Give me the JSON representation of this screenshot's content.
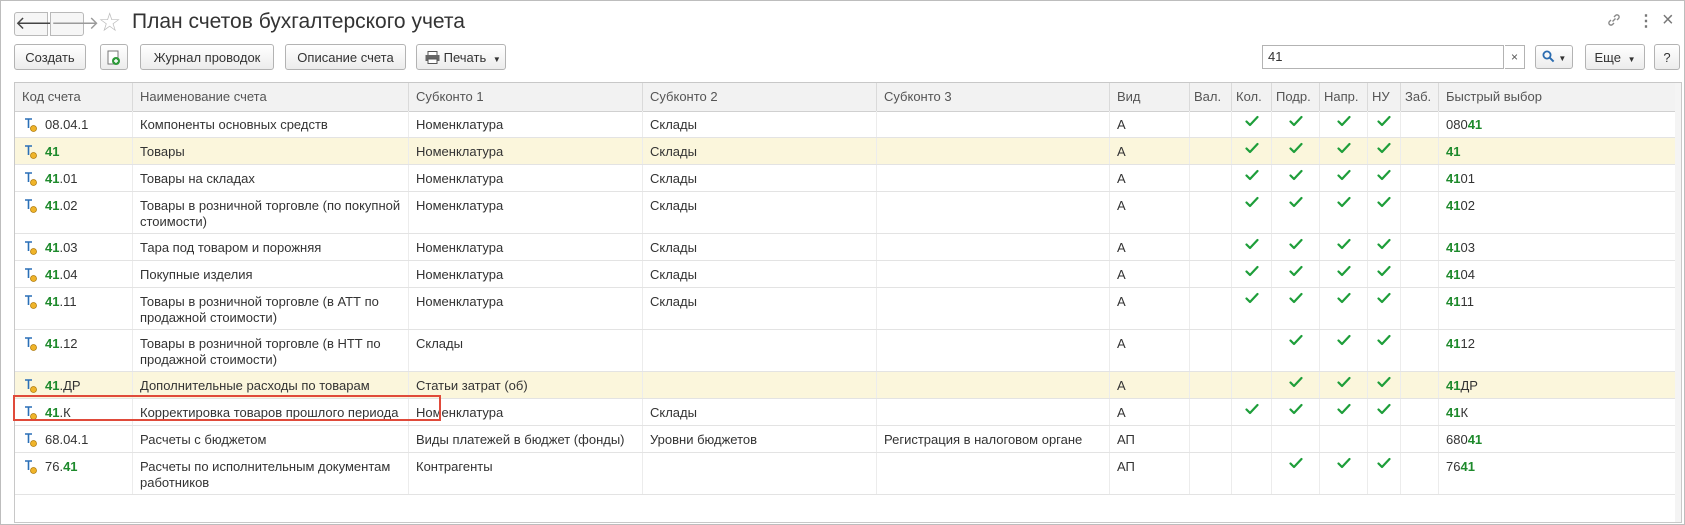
{
  "window": {
    "title": "План счетов бухгалтерского учета",
    "nav_back": "🡐",
    "nav_forward": "🡒",
    "link_icon": "link-icon",
    "menu_icon": "more-vert-icon",
    "close_icon": "close-icon"
  },
  "toolbar": {
    "create": "Создать",
    "journal": "Журнал проводок",
    "description": "Описание счета",
    "print": "Печать",
    "more": "Еще",
    "help": "?",
    "search_value": "41",
    "search_clear": "×"
  },
  "columns": [
    "Код счета",
    "Наименование счета",
    "Субконто 1",
    "Субконто 2",
    "Субконто 3",
    "Вид",
    "Вал.",
    "Кол.",
    "Подр.",
    "Напр.",
    "НУ",
    "Заб.",
    "Быстрый выбор"
  ],
  "rows": [
    {
      "code_pre": "08.04.1",
      "code_hit": "",
      "code_post": "",
      "name": "Компоненты основных средств",
      "s1": "Номенклатура",
      "s2": "Склады",
      "s3": "",
      "vid": "А",
      "kol": true,
      "podr": true,
      "napr": true,
      "nu": true,
      "qs_pre": "080",
      "qs_hit": "41",
      "qs_post": ""
    },
    {
      "code_pre": "",
      "code_hit": "41",
      "code_post": "",
      "name": "Товары",
      "s1": "Номенклатура",
      "s2": "Склады",
      "s3": "",
      "vid": "А",
      "kol": true,
      "podr": true,
      "napr": true,
      "nu": true,
      "qs_pre": "",
      "qs_hit": "41",
      "qs_post": "",
      "hl": true
    },
    {
      "code_pre": "",
      "code_hit": "41",
      "code_post": ".01",
      "name": "Товары на складах",
      "s1": "Номенклатура",
      "s2": "Склады",
      "s3": "",
      "vid": "А",
      "kol": true,
      "podr": true,
      "napr": true,
      "nu": true,
      "qs_pre": "",
      "qs_hit": "41",
      "qs_post": "01"
    },
    {
      "code_pre": "",
      "code_hit": "41",
      "code_post": ".02",
      "name": "Товары в розничной торговле (по покупной стоимости)",
      "s1": "Номенклатура",
      "s2": "Склады",
      "s3": "",
      "vid": "А",
      "kol": true,
      "podr": true,
      "napr": true,
      "nu": true,
      "qs_pre": "",
      "qs_hit": "41",
      "qs_post": "02"
    },
    {
      "code_pre": "",
      "code_hit": "41",
      "code_post": ".03",
      "name": "Тара под товаром и порожняя",
      "s1": "Номенклатура",
      "s2": "Склады",
      "s3": "",
      "vid": "А",
      "kol": true,
      "podr": true,
      "napr": true,
      "nu": true,
      "qs_pre": "",
      "qs_hit": "41",
      "qs_post": "03"
    },
    {
      "code_pre": "",
      "code_hit": "41",
      "code_post": ".04",
      "name": "Покупные изделия",
      "s1": "Номенклатура",
      "s2": "Склады",
      "s3": "",
      "vid": "А",
      "kol": true,
      "podr": true,
      "napr": true,
      "nu": true,
      "qs_pre": "",
      "qs_hit": "41",
      "qs_post": "04"
    },
    {
      "code_pre": "",
      "code_hit": "41",
      "code_post": ".11",
      "name": "Товары в розничной торговле (в АТТ по продажной стоимости)",
      "s1": "Номенклатура",
      "s2": "Склады",
      "s3": "",
      "vid": "А",
      "kol": true,
      "podr": true,
      "napr": true,
      "nu": true,
      "qs_pre": "",
      "qs_hit": "41",
      "qs_post": "11"
    },
    {
      "code_pre": "",
      "code_hit": "41",
      "code_post": ".12",
      "name": "Товары в розничной торговле (в НТТ по продажной стоимости)",
      "s1": "Склады",
      "s2": "",
      "s3": "",
      "vid": "А",
      "kol": false,
      "podr": true,
      "napr": true,
      "nu": true,
      "qs_pre": "",
      "qs_hit": "41",
      "qs_post": "12"
    },
    {
      "code_pre": "",
      "code_hit": "41",
      "code_post": ".ДР",
      "name": "Дополнительные расходы по товарам",
      "s1": "Статьи затрат (об)",
      "s2": "",
      "s3": "",
      "vid": "А",
      "kol": false,
      "podr": true,
      "napr": true,
      "nu": true,
      "qs_pre": "",
      "qs_hit": "41",
      "qs_post": "ДР",
      "hl": true
    },
    {
      "code_pre": "",
      "code_hit": "41",
      "code_post": ".К",
      "name": "Корректировка товаров прошлого периода",
      "s1": "Номенклатура",
      "s2": "Склады",
      "s3": "",
      "vid": "А",
      "kol": true,
      "podr": true,
      "napr": true,
      "nu": true,
      "qs_pre": "",
      "qs_hit": "41",
      "qs_post": "К"
    },
    {
      "code_pre": "68.04.1",
      "code_hit": "",
      "code_post": "",
      "name": "Расчеты с бюджетом",
      "s1": "Виды платежей в бюджет (фонды)",
      "s2": "Уровни бюджетов",
      "s3": "Регистрация в налоговом органе",
      "vid": "АП",
      "kol": false,
      "podr": false,
      "napr": false,
      "nu": false,
      "qs_pre": "680",
      "qs_hit": "41",
      "qs_post": ""
    },
    {
      "code_pre": "76.",
      "code_hit": "41",
      "code_post": "",
      "name": "Расчеты по исполнительным документам работников",
      "s1": "Контрагенты",
      "s2": "",
      "s3": "",
      "vid": "АП",
      "kol": false,
      "podr": true,
      "napr": true,
      "nu": true,
      "qs_pre": "76",
      "qs_hit": "41",
      "qs_post": ""
    }
  ]
}
